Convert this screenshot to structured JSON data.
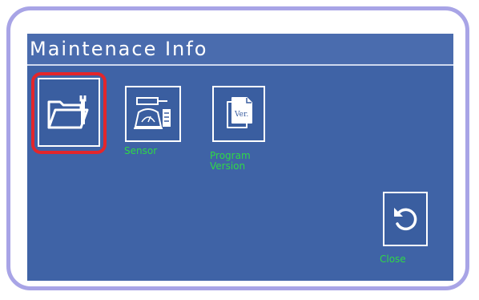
{
  "screen": {
    "title": "Maintenace Info"
  },
  "tiles": [
    {
      "name": "maintenance-folder",
      "label": "",
      "icon": "folder-wrench-icon",
      "selected": true
    },
    {
      "name": "sensor",
      "label": "Sensor",
      "icon": "sensor-scale-icon",
      "selected": false
    },
    {
      "name": "program-version",
      "label_line1": "Program",
      "label_line2": "Version",
      "icon": "document-version-icon",
      "selected": false
    }
  ],
  "close": {
    "label": "Close",
    "icon": "undo-arrow-icon"
  },
  "colors": {
    "frame": "#a8a4e6",
    "screen_bg": "#3f63a6",
    "label_green": "#2fd846",
    "selection_red": "#e3262b"
  }
}
